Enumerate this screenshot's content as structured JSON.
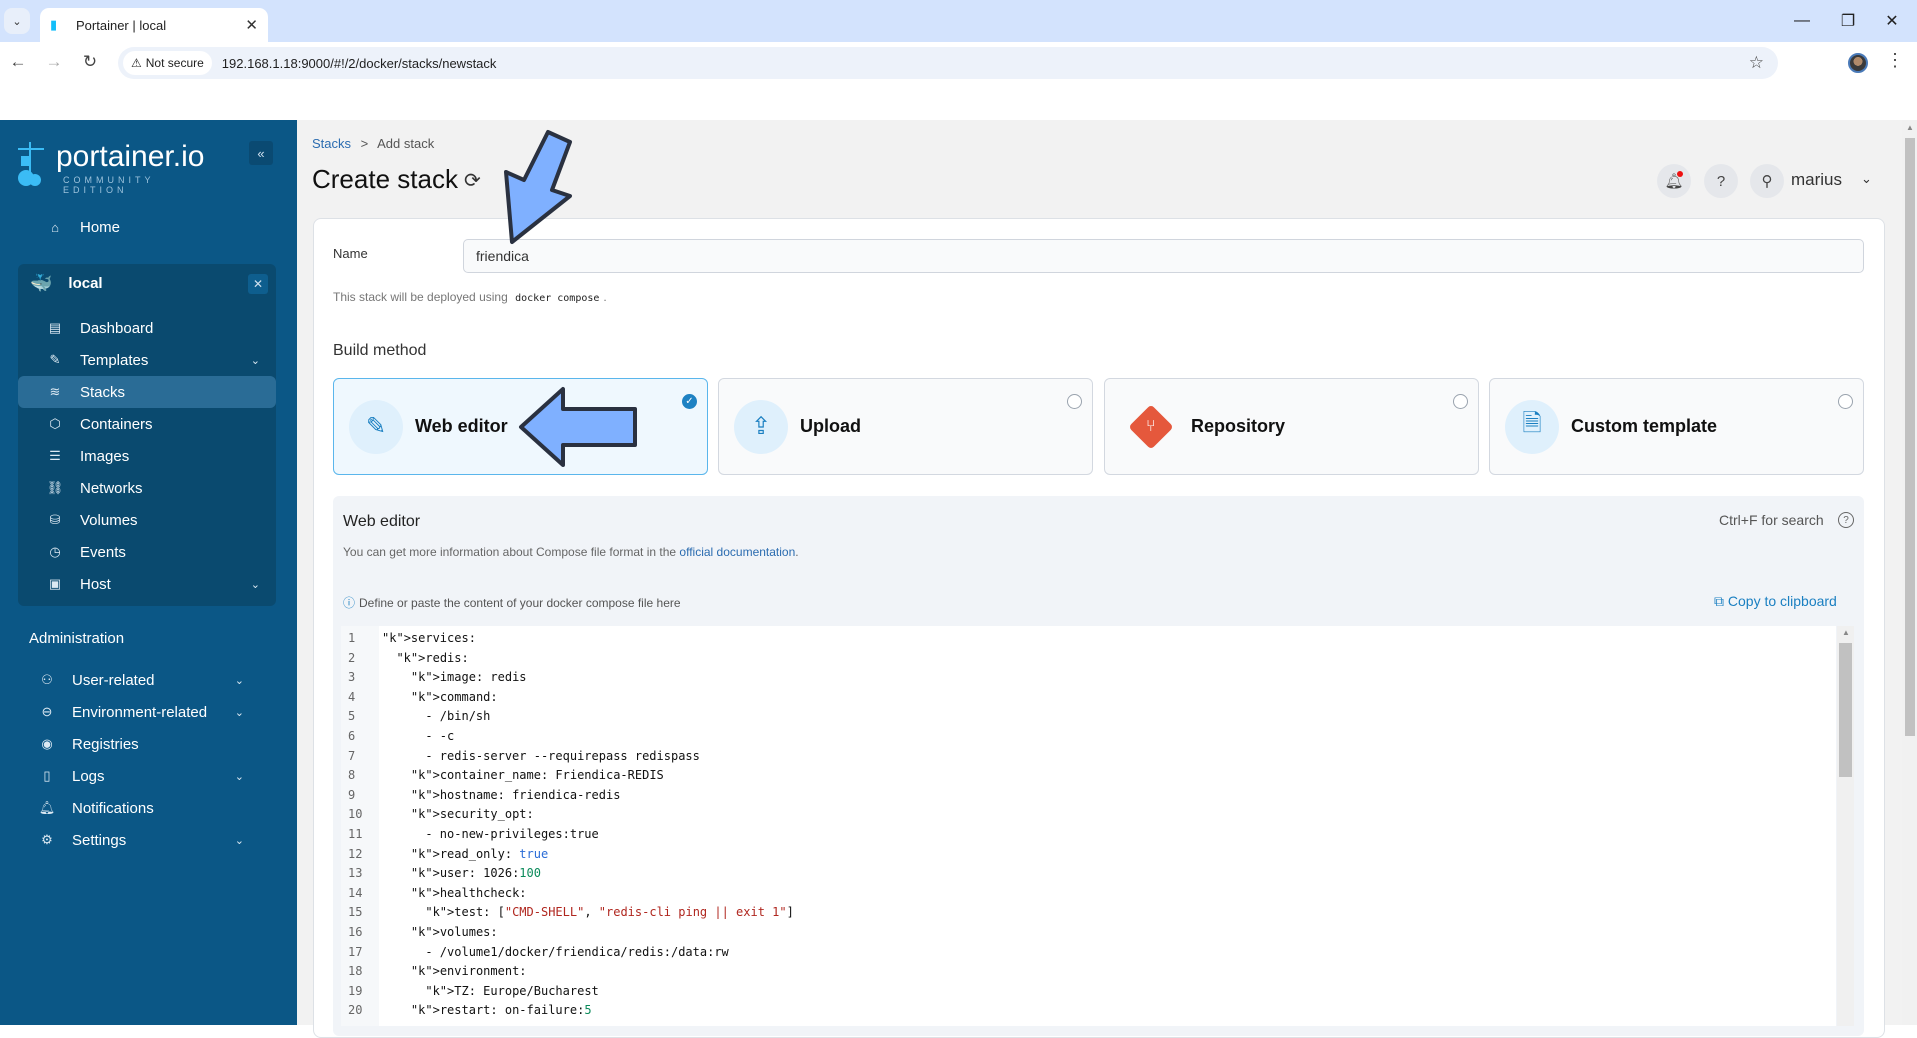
{
  "browser": {
    "tab_title": "Portainer | local",
    "not_secure_label": "Not secure",
    "url": "192.168.1.18:9000/#!/2/docker/stacks/newstack"
  },
  "sidebar": {
    "brand": "portainer.io",
    "edition": "COMMUNITY EDITION",
    "home_label": "Home",
    "environment": {
      "name": "local",
      "items": [
        {
          "label": "Dashboard",
          "icon": "dashboard-icon"
        },
        {
          "label": "Templates",
          "icon": "edit-icon",
          "expandable": true
        },
        {
          "label": "Stacks",
          "icon": "layers-icon",
          "active": true
        },
        {
          "label": "Containers",
          "icon": "box-icon"
        },
        {
          "label": "Images",
          "icon": "list-icon"
        },
        {
          "label": "Networks",
          "icon": "network-icon"
        },
        {
          "label": "Volumes",
          "icon": "database-icon"
        },
        {
          "label": "Events",
          "icon": "clock-icon"
        },
        {
          "label": "Host",
          "icon": "server-icon",
          "expandable": true
        }
      ]
    },
    "admin_heading": "Administration",
    "admin_items": [
      {
        "label": "User-related",
        "icon": "users-icon",
        "expandable": true
      },
      {
        "label": "Environment-related",
        "icon": "drive-icon",
        "expandable": true
      },
      {
        "label": "Registries",
        "icon": "broadcast-icon"
      },
      {
        "label": "Logs",
        "icon": "file-icon",
        "expandable": true
      },
      {
        "label": "Notifications",
        "icon": "bell-icon"
      },
      {
        "label": "Settings",
        "icon": "gear-icon",
        "expandable": true
      }
    ]
  },
  "header": {
    "breadcrumb_root": "Stacks",
    "breadcrumb_sep": ">",
    "breadcrumb_current": "Add stack",
    "title": "Create stack",
    "username": "marius"
  },
  "form": {
    "name_label": "Name",
    "name_value": "friendica",
    "deploy_note_prefix": "This stack will be deployed using",
    "deploy_note_code": "docker compose",
    "deploy_note_suffix": ".",
    "build_method_label": "Build method",
    "build_methods": [
      {
        "label": "Web editor",
        "selected": true
      },
      {
        "label": "Upload",
        "selected": false
      },
      {
        "label": "Repository",
        "selected": false
      },
      {
        "label": "Custom template",
        "selected": false
      }
    ]
  },
  "editor": {
    "title": "Web editor",
    "search_hint": "Ctrl+F for search",
    "info_prefix": "You can get more information about Compose file format in the",
    "info_link": "official documentation",
    "info_suffix": ".",
    "define_hint": "Define or paste the content of your docker compose file here",
    "copy_label": "Copy to clipboard",
    "lines": [
      "services:",
      "  redis:",
      "    image: redis",
      "    command:",
      "      - /bin/sh",
      "      - -c",
      "      - redis-server --requirepass redispass",
      "    container_name: Friendica-REDIS",
      "    hostname: friendica-redis",
      "    security_opt:",
      "      - no-new-privileges:true",
      "    read_only: true",
      "    user: 1026:100",
      "    healthcheck:",
      "      test: [\"CMD-SHELL\", \"redis-cli ping || exit 1\"]",
      "    volumes:",
      "      - /volume1/docker/friendica/redis:/data:rw",
      "    environment:",
      "      TZ: Europe/Bucharest",
      "    restart: on-failure:5"
    ]
  }
}
